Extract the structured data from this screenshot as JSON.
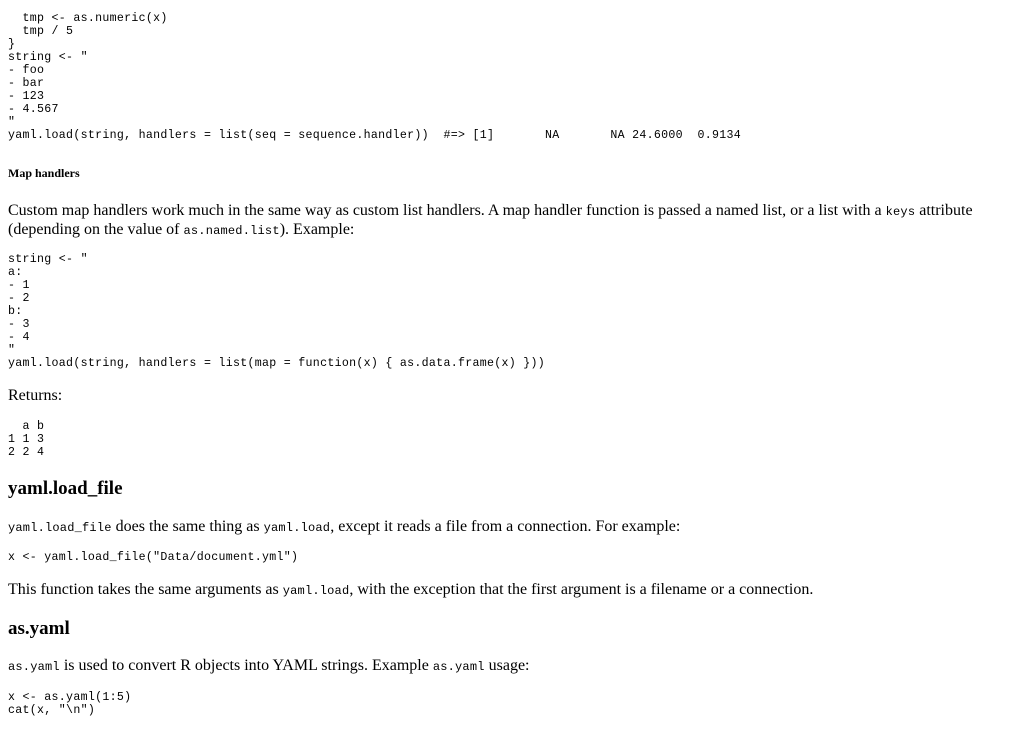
{
  "code_top": "  tmp <- as.numeric(x)\n  tmp / 5\n}\nstring <- \"\n- foo\n- bar\n- 123\n- 4.567\n\"",
  "code_seq_call": "yaml.load(string, handlers = list(seq = sequence.handler))  #=> [1]       NA       NA 24.6000  0.9134",
  "map_handlers": {
    "heading": "Map handlers",
    "para_text_1": "Custom map handlers work much in the same way as custom list handlers. A map handler function is passed a named list, or a list with a ",
    "para_code_1": "keys",
    "para_text_2": " attribute (depending on the value of ",
    "para_code_2": "as.named.list",
    "para_text_3": "). Example:",
    "code_example": "string <- \"\na:\n- 1\n- 2\nb:\n- 3\n- 4\n\"\nyaml.load(string, handlers = list(map = function(x) { as.data.frame(x) }))",
    "returns_label": "Returns:",
    "returns_output": "  a b\n1 1 3\n2 2 4"
  },
  "load_file": {
    "heading": "yaml.load_file",
    "para_code_1": "yaml.load_file",
    "para_text_1": " does the same thing as ",
    "para_code_2": "yaml.load",
    "para_text_2": ", except it reads a file from a connection. For example:",
    "code_example": "x <- yaml.load_file(\"Data/document.yml\")",
    "para2_text_1": "This function takes the same arguments as ",
    "para2_code_1": "yaml.load",
    "para2_text_2": ", with the exception that the first argument is a filename or a connection."
  },
  "as_yaml": {
    "heading": "as.yaml",
    "para_code_1": "as.yaml",
    "para_text_1": " is used to convert R objects into YAML strings. Example ",
    "para_code_2": "as.yaml",
    "para_text_2": " usage:",
    "code_example": "x <- as.yaml(1:5)\ncat(x, \"\\n\")"
  }
}
